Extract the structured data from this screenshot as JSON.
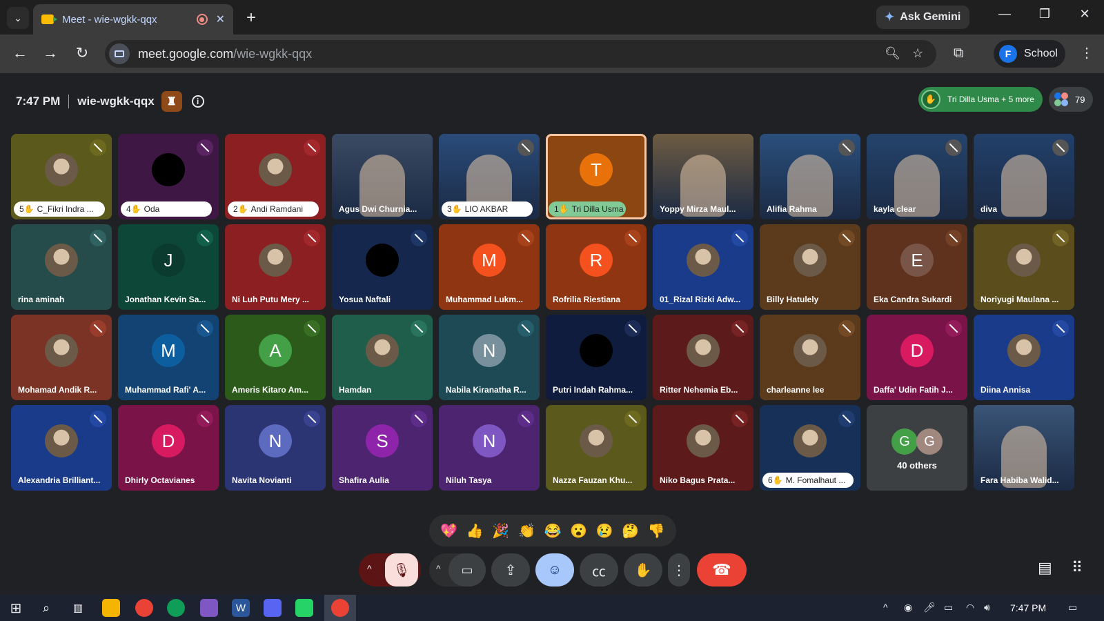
{
  "browser": {
    "tab_title": "Meet - wie-wgkk-qqx",
    "new_tab_icon": "+",
    "ask_gemini_label": "Ask Gemini",
    "url_host": "meet.google.com",
    "url_path": "/wie-wgkk-qqx",
    "profile_initial": "F",
    "profile_name": "School"
  },
  "meeting": {
    "time": "7:47 PM",
    "code": "wie-wgkk-qqx",
    "raised_hands": "Tri Dilla Usma + 5 more",
    "participant_count": "79"
  },
  "tiles": [
    {
      "name": "C_Fikri Indra ...",
      "hand": "5",
      "type": "photo",
      "bg": "#5b5a1c",
      "mic": "#6d6a20"
    },
    {
      "name": "Oda",
      "hand": "4",
      "type": "photo",
      "bg": "#3e1744",
      "mic": "#5a2463",
      "dark": true
    },
    {
      "name": "Andi Ramdani",
      "hand": "2",
      "type": "photo",
      "bg": "#8b1f21",
      "mic": "#a2282b"
    },
    {
      "name": "Agus Dwi Churnia...",
      "type": "video",
      "bg": "#3b4a63"
    },
    {
      "name": "LIO AKBAR",
      "hand": "3",
      "type": "video",
      "bg": "#2a4b7a",
      "mic": "#555"
    },
    {
      "name": "Tri Dilla Usma",
      "hand": "1",
      "type": "initial",
      "initial": "T",
      "bg": "#8c4611",
      "avatar": "#e8710a",
      "speaking": true
    },
    {
      "name": "Yoppy Mirza Maul...",
      "type": "video",
      "bg": "#6d5b42"
    },
    {
      "name": "Alifia Rahma",
      "type": "video",
      "bg": "#2a4f7c",
      "mic": "#555"
    },
    {
      "name": "kayla clear",
      "type": "video",
      "bg": "#24436b",
      "mic": "#555"
    },
    {
      "name": "diva",
      "type": "video",
      "bg": "#22406a",
      "mic": "#555"
    },
    {
      "name": "rina aminah",
      "type": "photo",
      "bg": "#254c4a",
      "mic": "#2f6260"
    },
    {
      "name": "Jonathan Kevin Sa...",
      "type": "initial",
      "initial": "J",
      "bg": "#0d4738",
      "avatar": "#0b3a2e",
      "mic": "#13604a"
    },
    {
      "name": "Ni Luh Putu Mery ...",
      "type": "photo",
      "bg": "#8b1f21",
      "mic": "#a2282b"
    },
    {
      "name": "Yosua Naftali",
      "type": "photo",
      "bg": "#15274d",
      "mic": "#1f3766",
      "dark": true
    },
    {
      "name": "Muhammad Lukm...",
      "type": "initial",
      "initial": "M",
      "bg": "#8f3512",
      "avatar": "#f4511e",
      "mic": "#a8421b"
    },
    {
      "name": "Rofrilia Riestiana",
      "type": "initial",
      "initial": "R",
      "bg": "#8f3512",
      "avatar": "#f4511e",
      "mic": "#a8421b"
    },
    {
      "name": "01_Rizal Rizki Adw...",
      "type": "photo",
      "bg": "#1a3a8a",
      "mic": "#2449a3"
    },
    {
      "name": "Billy Hatulely",
      "type": "photo",
      "bg": "#5c3a1c",
      "mic": "#744a25"
    },
    {
      "name": "Eka Candra Sukardi",
      "type": "initial",
      "initial": "E",
      "bg": "#5e321d",
      "avatar": "#795548",
      "mic": "#744026"
    },
    {
      "name": "Noriyugi Maulana ...",
      "type": "photo",
      "bg": "#5b4e1c",
      "mic": "#736324"
    },
    {
      "name": "Mohamad Andik R...",
      "type": "photo",
      "bg": "#7b3325",
      "mic": "#9a3c2c"
    },
    {
      "name": "Muhammad Rafi' A...",
      "type": "initial",
      "initial": "M",
      "bg": "#134372",
      "avatar": "#0d5e9e",
      "mic": "#1a568f"
    },
    {
      "name": "Ameris Kitaro Am...",
      "type": "initial",
      "initial": "A",
      "bg": "#2b5a1b",
      "avatar": "#43a047",
      "mic": "#386f24"
    },
    {
      "name": "Hamdan",
      "type": "photo",
      "bg": "#1f5e4b",
      "mic": "#28745d"
    },
    {
      "name": "Nabila Kiranatha R...",
      "type": "initial",
      "initial": "N",
      "bg": "#1d4a55",
      "avatar": "#78909c",
      "mic": "#275e6c"
    },
    {
      "name": "Putri Indah Rahma...",
      "type": "photo",
      "bg": "#0f1c3d",
      "mic": "#1b2c57",
      "dark": true
    },
    {
      "name": "Ritter Nehemia Eb...",
      "type": "photo",
      "bg": "#5d1a1a",
      "mic": "#772323"
    },
    {
      "name": "charleanne lee",
      "type": "photo",
      "bg": "#5c3a1c",
      "mic": "#744a25"
    },
    {
      "name": "Daffa' Udin Fatih J...",
      "type": "initial",
      "initial": "D",
      "bg": "#7a1448",
      "avatar": "#d81b60",
      "mic": "#931b59"
    },
    {
      "name": "Diina Annisa",
      "type": "photo",
      "bg": "#1a3a8a",
      "mic": "#2449a3"
    },
    {
      "name": "Alexandria Brilliant...",
      "type": "photo",
      "bg": "#1a3a8a",
      "mic": "#2449a3"
    },
    {
      "name": "Dhirly Octavianes",
      "type": "initial",
      "initial": "D",
      "bg": "#7a1448",
      "avatar": "#d81b60",
      "mic": "#931b59"
    },
    {
      "name": "Navita Novianti",
      "type": "initial",
      "initial": "N",
      "bg": "#2c3574",
      "avatar": "#5c6bc0",
      "mic": "#38428f"
    },
    {
      "name": "Shafira Aulia",
      "type": "initial",
      "initial": "S",
      "bg": "#4d2470",
      "avatar": "#8e24aa",
      "mic": "#5e2d8a"
    },
    {
      "name": "Niluh Tasya",
      "type": "initial",
      "initial": "N",
      "bg": "#4d2470",
      "avatar": "#7e57c2",
      "mic": "#5e2d8a"
    },
    {
      "name": "Nazza Fauzan Khu...",
      "type": "photo",
      "bg": "#5b5a1c",
      "mic": "#6d6a20"
    },
    {
      "name": "Niko Bagus Prata...",
      "type": "photo",
      "bg": "#5d1a1a",
      "mic": "#772323"
    },
    {
      "name": "M. Fomalhaut ...",
      "hand": "6",
      "type": "photo",
      "bg": "#163058",
      "mic": "#1f3d70"
    },
    {
      "name": "Fara Habiba Walid...",
      "type": "video",
      "bg": "#3a5577"
    }
  ],
  "others": {
    "initials": [
      "G",
      "G"
    ],
    "label": "40 others"
  },
  "reactions": [
    "💖",
    "👍",
    "🎉",
    "👏",
    "😂",
    "😮",
    "😢",
    "🤔",
    "👎"
  ],
  "taskbar": {
    "clock": "7:47 PM"
  }
}
